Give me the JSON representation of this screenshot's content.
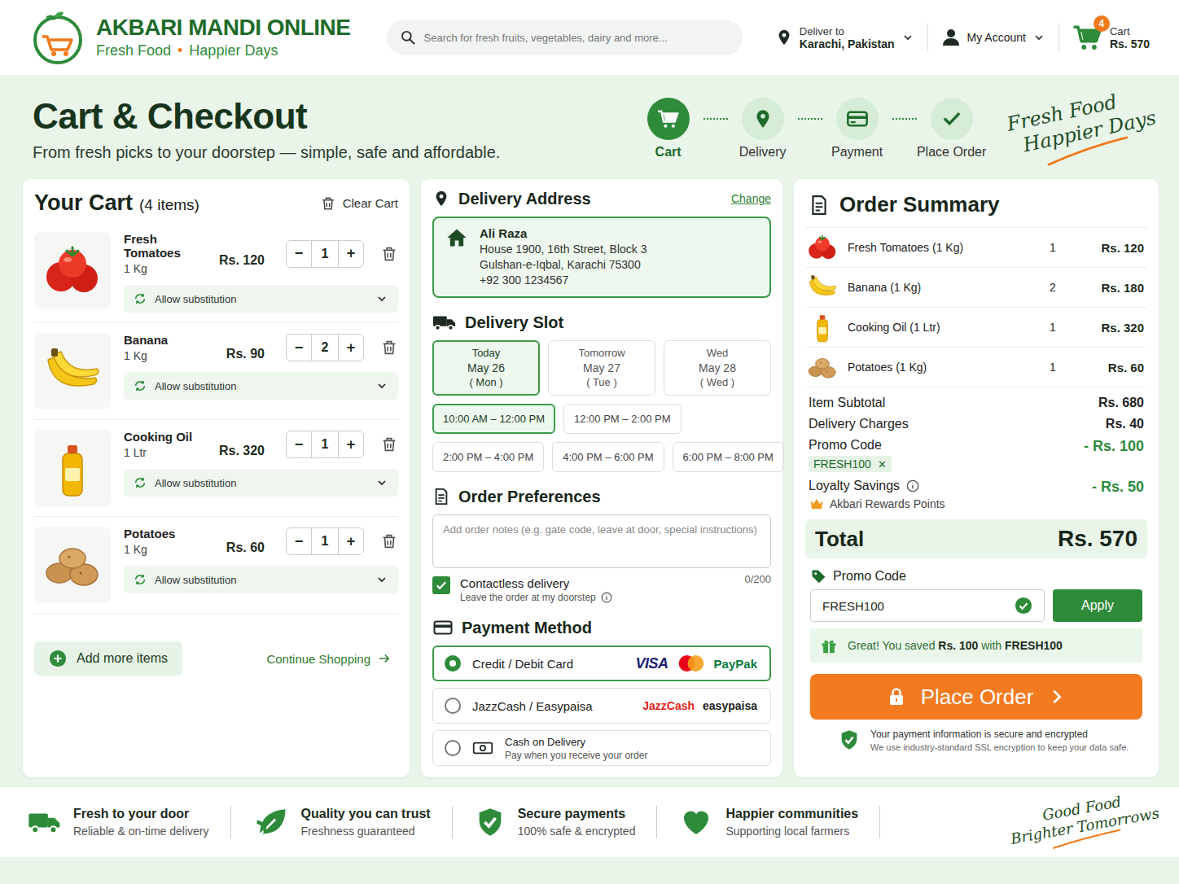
{
  "header": {
    "brand": {
      "name": "AKBARI MANDI ONLINE",
      "tagline_left": "Fresh Food",
      "tagline_dot": "•",
      "tagline_right": "Happier Days"
    },
    "search": {
      "placeholder": "Search for fresh fruits, vegetables, dairy and more..."
    },
    "location": {
      "label": "Deliver to",
      "value": "Karachi, Pakistan"
    },
    "account": {
      "label": "My Account"
    },
    "cart": {
      "badge": "4",
      "label": "Cart",
      "total": "Rs. 570"
    }
  },
  "page": {
    "title": "Cart & Checkout",
    "subtitle": "From fresh picks to your doorstep — simple, safe and affordable.",
    "script": [
      "Fresh Food",
      "Happier Days"
    ]
  },
  "steps": [
    {
      "label": "Cart",
      "selected": true
    },
    {
      "label": "Delivery",
      "selected": false
    },
    {
      "label": "Payment",
      "selected": false
    },
    {
      "label": "Place Order",
      "selected": false
    }
  ],
  "cart": {
    "title": "Your Cart",
    "count": "(4 items)",
    "clear": "Clear Cart",
    "stepper": {
      "minus": "−",
      "plus": "+"
    },
    "items": [
      {
        "kind": "tomato",
        "name": "Fresh Tomatoes",
        "unit": "1 Kg",
        "price": "Rs. 120",
        "qty": "1",
        "substitution": "Allow substitution"
      },
      {
        "kind": "banana",
        "name": "Banana",
        "unit": "1 Kg",
        "price": "Rs. 90",
        "qty": "2",
        "substitution": "Allow substitution"
      },
      {
        "kind": "oil",
        "name": "Cooking Oil",
        "unit": "1 Ltr",
        "price": "Rs. 320",
        "qty": "1",
        "substitution": "Allow substitution"
      },
      {
        "kind": "potato",
        "name": "Potatoes",
        "unit": "1 Kg",
        "price": "Rs. 60",
        "qty": "1",
        "substitution": "Allow substitution"
      }
    ],
    "add_more": "Add more items",
    "continue": "Continue Shopping"
  },
  "address": {
    "title": "Delivery Address",
    "change": "Change",
    "name": "Ali Raza",
    "lines": [
      "House 1900, 16th Street, Block 3",
      "Gulshan-e-Iqbal, Karachi 75300"
    ],
    "phone": "+92 300 1234567"
  },
  "slot": {
    "title": "Delivery Slot",
    "days": [
      {
        "label": "Today",
        "date": "May 26",
        "weekday": "( Mon )",
        "selected": true
      },
      {
        "label": "Tomorrow",
        "date": "May 27",
        "weekday": "( Tue )",
        "selected": false
      },
      {
        "label": "Wed",
        "date": "May 28",
        "weekday": "( Wed )",
        "selected": false
      }
    ],
    "time_rows": [
      [
        {
          "label": "10:00 AM – 12:00 PM",
          "selected": true
        },
        {
          "label": "12:00 PM – 2:00 PM",
          "selected": false
        }
      ],
      [
        {
          "label": "2:00 PM – 4:00 PM",
          "selected": false
        },
        {
          "label": "4:00 PM – 6:00 PM",
          "selected": false
        },
        {
          "label": "6:00 PM – 8:00 PM",
          "selected": false
        }
      ]
    ]
  },
  "preferences": {
    "title": "Order Preferences",
    "placeholder": "Add order notes (e.g. gate code, leave at door, special instructions)",
    "counter": "0/200",
    "contactless": {
      "label": "Contactless delivery",
      "hint": "Leave the order at my doorstep",
      "checked": true
    }
  },
  "payment": {
    "title": "Payment Method",
    "methods": [
      {
        "kind": "card",
        "label": "Credit / Debit Card",
        "selected": true,
        "logos": [
          {
            "kind": "visa",
            "text": "VISA"
          },
          {
            "kind": "mastercard"
          },
          {
            "kind": "paypak",
            "text": "PayPak"
          }
        ]
      },
      {
        "kind": "wallet",
        "label": "JazzCash / Easypaisa",
        "selected": false,
        "logos": [
          {
            "kind": "jazzcash",
            "text": "JazzCash"
          },
          {
            "kind": "easypaisa",
            "text": "easypaisa"
          }
        ]
      },
      {
        "kind": "cash",
        "label": "Cash on Delivery",
        "note": "Pay when you receive your order",
        "selected": false,
        "logos": []
      }
    ]
  },
  "summary": {
    "title": "Order Summary",
    "items": [
      {
        "kind": "tomato",
        "name": "Fresh Tomatoes (1 Kg)",
        "qty": "1",
        "price": "Rs. 120"
      },
      {
        "kind": "banana",
        "name": "Banana (1 Kg)",
        "qty": "2",
        "price": "Rs. 180"
      },
      {
        "kind": "oil",
        "name": "Cooking Oil (1 Ltr)",
        "qty": "1",
        "price": "Rs. 320"
      },
      {
        "kind": "potato",
        "name": "Potatoes (1 Kg)",
        "qty": "1",
        "price": "Rs. 60"
      }
    ],
    "subtotal": {
      "label": "Item Subtotal",
      "value": "Rs. 680"
    },
    "delivery": {
      "label": "Delivery Charges",
      "value": "Rs. 40"
    },
    "promo": {
      "label": "Promo Code",
      "value": "- Rs. 100",
      "tag": "FRESH100",
      "remove": "✕"
    },
    "loyalty": {
      "label": "Loyalty Savings",
      "value": "- Rs. 50",
      "note": "Akbari Rewards Points"
    },
    "total": {
      "label": "Total",
      "value": "Rs. 570"
    }
  },
  "promo_form": {
    "label": "Promo Code",
    "value": "FRESH100",
    "valid": true,
    "apply": "Apply",
    "message": {
      "before": "Great! You saved ",
      "amount": "Rs. 100",
      "middle": " with ",
      "code": "FRESH100"
    }
  },
  "place_order": "Place Order",
  "secure": {
    "title": "Your payment information is secure and encrypted",
    "text": "We use industry-standard SSL encryption to keep your data safe."
  },
  "features": [
    {
      "title": "Fresh to your door",
      "text": "Reliable & on-time delivery"
    },
    {
      "title": "Quality you can trust",
      "text": "Freshness guaranteed"
    },
    {
      "title": "Secure payments",
      "text": "100% safe & encrypted"
    },
    {
      "title": "Happier communities",
      "text": "Supporting local farmers"
    }
  ],
  "footer_script": [
    "Good Food",
    "Brighter Tomorrows"
  ]
}
